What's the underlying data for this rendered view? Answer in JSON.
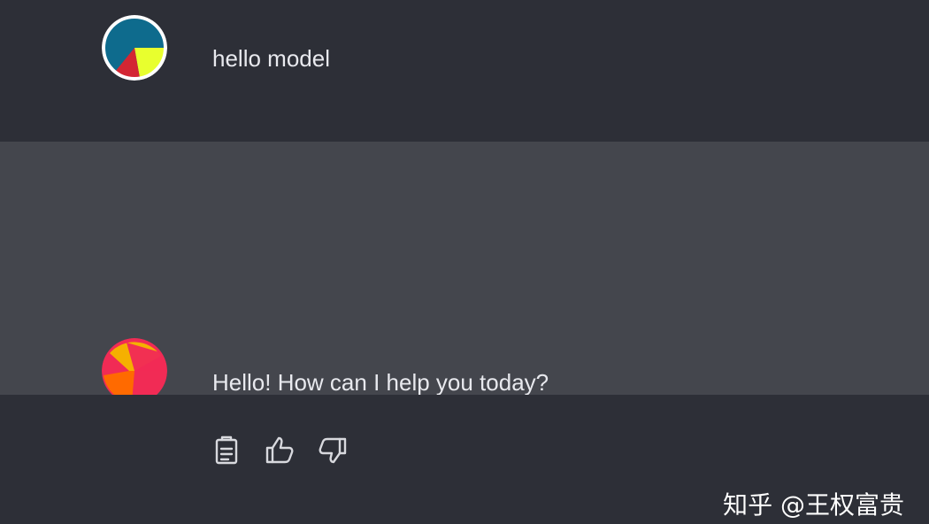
{
  "conversation": {
    "user": {
      "avatar": "user-pie-avatar",
      "message": "hello model"
    },
    "assistant": {
      "avatar": "assistant-pie-avatar",
      "message": "Hello! How can I help you today?",
      "actions": [
        {
          "icon": "clipboard-icon"
        },
        {
          "icon": "thumbs-up-icon"
        },
        {
          "icon": "thumbs-down-icon"
        }
      ]
    }
  },
  "watermark": {
    "text": "知乎 @王权富贵"
  },
  "colors": {
    "user_row_background": "#2d2f37",
    "assistant_row_background": "#44464d",
    "text": "#e8e9ee"
  }
}
